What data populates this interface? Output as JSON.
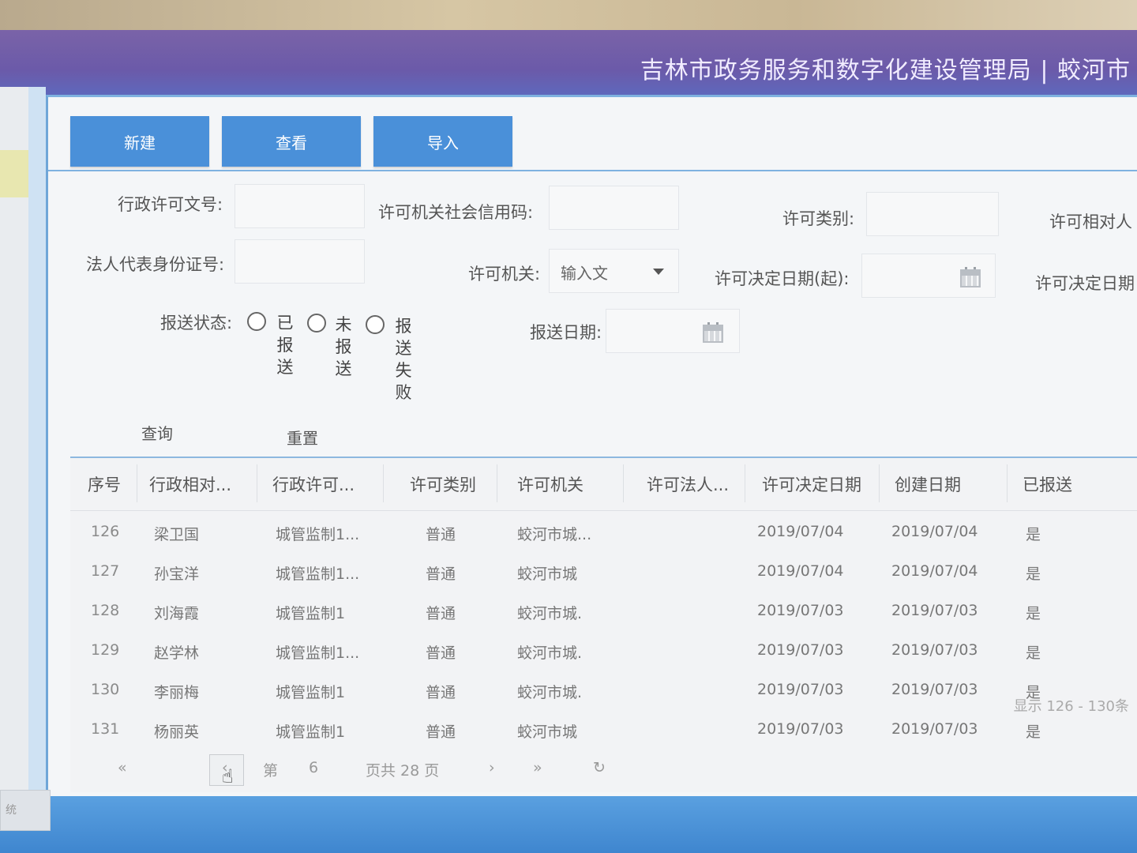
{
  "header": {
    "title": "吉林市政务服务和数字化建设管理局 | 蛟河市"
  },
  "toolbar": {
    "new_label": "新建",
    "view_label": "查看",
    "import_label": "导入"
  },
  "form": {
    "license_doc_no_label": "行政许可文号:",
    "authority_credit_code_label": "许可机关社会信用码:",
    "license_category_label": "许可类别:",
    "license_counterparty_label": "许可相对人",
    "legal_rep_id_label": "法人代表身份证号:",
    "authority_label": "许可机关:",
    "authority_placeholder": "输入文",
    "decision_date_start_label": "许可决定日期(起):",
    "decision_date_end_label": "许可决定日期",
    "report_status_label": "报送状态:",
    "report_options": [
      "已报送",
      "未报送",
      "报送失败"
    ],
    "report_date_label": "报送日期:",
    "query_label": "查询",
    "reset_label": "重置"
  },
  "table": {
    "columns": [
      "序号",
      "行政相对...",
      "行政许可...",
      "许可类别",
      "许可机关",
      "许可法人...",
      "许可决定日期",
      "创建日期",
      "已报送"
    ],
    "rows": [
      [
        "126",
        "梁卫国",
        "城管监制1...",
        "普通",
        "蛟河市城...",
        "",
        "2019/07/04",
        "2019/07/04",
        "是"
      ],
      [
        "127",
        "孙宝洋",
        "城管监制1...",
        "普通",
        "蛟河市城",
        "",
        "2019/07/04",
        "2019/07/04",
        "是"
      ],
      [
        "128",
        "刘海霞",
        "城管监制1",
        "普通",
        "蛟河市城.",
        "",
        "2019/07/03",
        "2019/07/03",
        "是"
      ],
      [
        "129",
        "赵学林",
        "城管监制1...",
        "普通",
        "蛟河市城.",
        "",
        "2019/07/03",
        "2019/07/03",
        "是"
      ],
      [
        "130",
        "李丽梅",
        "城管监制1",
        "普通",
        "蛟河市城.",
        "",
        "2019/07/03",
        "2019/07/03",
        "是"
      ],
      [
        "131",
        "杨丽英",
        "城管监制1",
        "普通",
        "蛟河市城",
        "",
        "2019/07/03",
        "2019/07/03",
        "是"
      ]
    ]
  },
  "pager": {
    "first": "«",
    "prev": "‹",
    "page_prefix": "第",
    "current_page": "6",
    "page_suffix": "页共 28 页",
    "next": "›",
    "last": "»",
    "refresh": "↻",
    "summary": "显示 126 - 130条"
  },
  "bottom": {
    "tab_label": "统"
  },
  "colors": {
    "accent": "#4a90d9",
    "banner": "#6b5aa9"
  }
}
